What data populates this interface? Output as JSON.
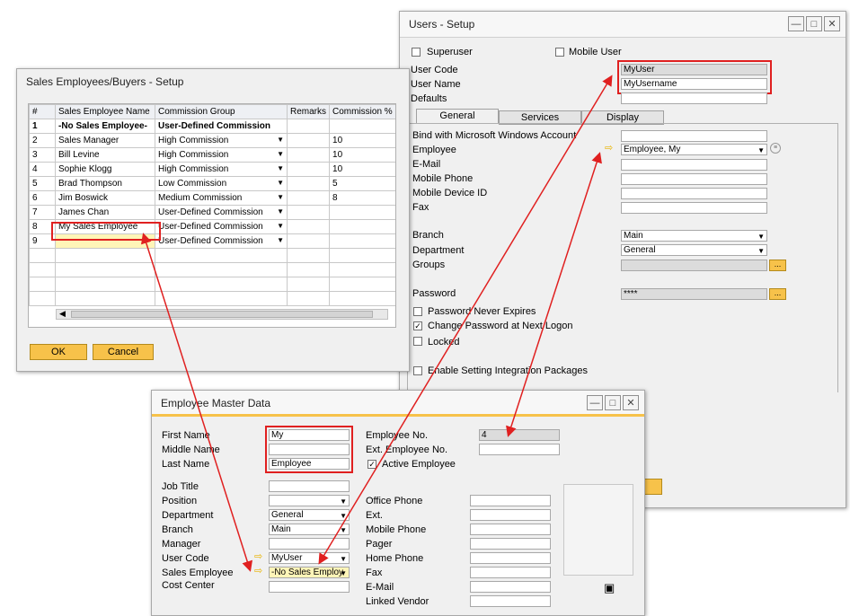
{
  "users": {
    "title": "Users - Setup",
    "superuser": "Superuser",
    "mobile_user": "Mobile User",
    "user_code_label": "User Code",
    "user_code": "MyUser",
    "user_name_label": "User Name",
    "user_name": "MyUsername",
    "defaults_label": "Defaults",
    "tabs": [
      "General",
      "Services",
      "Display"
    ],
    "bind_label": "Bind with Microsoft Windows Account",
    "employee_label": "Employee",
    "employee_value": "Employee, My",
    "email_label": "E-Mail",
    "mobile_phone_label": "Mobile Phone",
    "mobile_device_label": "Mobile Device ID",
    "fax_label": "Fax",
    "branch_label": "Branch",
    "branch_value": "Main",
    "department_label": "Department",
    "department_value": "General",
    "groups_label": "Groups",
    "password_label": "Password",
    "password_value": "****",
    "pw_never_expires": "Password Never Expires",
    "change_pw": "Change Password at Next Logon",
    "locked": "Locked",
    "enable_integration": "Enable Setting Integration Packages"
  },
  "sales": {
    "title": "Sales Employees/Buyers - Setup",
    "columns": [
      "#",
      "Sales Employee Name",
      "Commission Group",
      "Remarks",
      "Commission %"
    ],
    "rows": [
      {
        "num": "1",
        "name": "-No Sales Employee-",
        "group": "User-Defined Commission",
        "pct": ""
      },
      {
        "num": "2",
        "name": "Sales Manager",
        "group": "High Commission",
        "pct": "10"
      },
      {
        "num": "3",
        "name": "Bill Levine",
        "group": "High Commission",
        "pct": "10"
      },
      {
        "num": "4",
        "name": "Sophie Klogg",
        "group": "High Commission",
        "pct": "10"
      },
      {
        "num": "5",
        "name": "Brad Thompson",
        "group": "Low Commission",
        "pct": "5"
      },
      {
        "num": "6",
        "name": "Jim Boswick",
        "group": "Medium Commission",
        "pct": "8"
      },
      {
        "num": "7",
        "name": "James Chan",
        "group": "User-Defined Commission",
        "pct": ""
      },
      {
        "num": "8",
        "name": "My Sales Employee",
        "group": "User-Defined Commission",
        "pct": ""
      },
      {
        "num": "9",
        "name": "",
        "group": "User-Defined Commission",
        "pct": ""
      }
    ],
    "ok": "OK",
    "cancel": "Cancel"
  },
  "emp": {
    "title": "Employee Master Data",
    "first_name_label": "First Name",
    "first_name": "My",
    "middle_name_label": "Middle Name",
    "last_name_label": "Last Name",
    "last_name": "Employee",
    "emp_no_label": "Employee No.",
    "emp_no": "4",
    "ext_emp_no_label": "Ext. Employee No.",
    "active_label": "Active Employee",
    "job_title_label": "Job Title",
    "position_label": "Position",
    "department_label": "Department",
    "department_value": "General",
    "branch_label": "Branch",
    "branch_value": "Main",
    "manager_label": "Manager",
    "user_code_label": "User Code",
    "user_code_value": "MyUser",
    "sales_emp_label": "Sales Employee",
    "sales_emp_value": "-No Sales Employ",
    "cost_center_label": "Cost Center",
    "office_phone_label": "Office Phone",
    "ext_label": "Ext.",
    "mobile_phone_label": "Mobile Phone",
    "pager_label": "Pager",
    "home_phone_label": "Home Phone",
    "fax_label": "Fax",
    "email_label": "E-Mail",
    "linked_vendor_label": "Linked Vendor"
  },
  "colors": {
    "accent": "#f7c24a",
    "highlight": "#e02020",
    "arrow": "#e8b400"
  }
}
